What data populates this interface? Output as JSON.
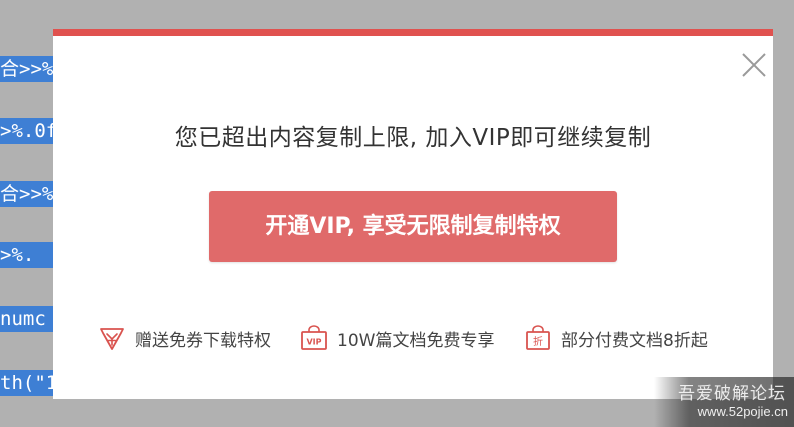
{
  "background": {
    "code_lines": [
      "合>>%",
      ">%.0f",
      "合>>%",
      ">%.",
      "numc",
      "th(\"1"
    ]
  },
  "modal": {
    "accent_color": "#e0524f",
    "title": "您已超出内容复制上限, 加入VIP即可继续复制",
    "cta_label": "开通VIP, 享受无限制复制特权",
    "cta_color": "#e06a6a",
    "benefits": [
      {
        "icon": "gift-ticket-icon",
        "label": "赠送免券下载特权"
      },
      {
        "icon": "vip-bag-icon",
        "label": "10W篇文档免费专享"
      },
      {
        "icon": "discount-bag-icon",
        "label": "部分付费文档8折起"
      }
    ],
    "close_icon": "close-icon"
  },
  "watermark": {
    "name": "吾爱破解论坛",
    "url": "www.52pojie.cn"
  }
}
